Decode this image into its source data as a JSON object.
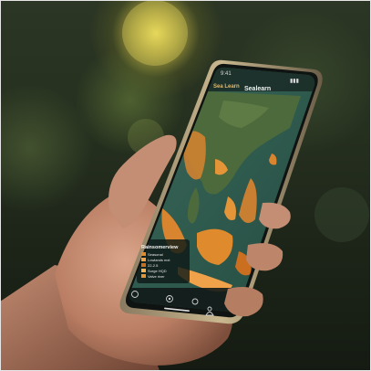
{
  "photo": {
    "description_tag": "hand-holding-smartphone",
    "accent_land": "#d9842f",
    "accent_sea": "#2f5a4e"
  },
  "phone": {
    "status_time": "9:41",
    "status_icons": "▮▮▮",
    "header": {
      "left_label": "Sea Learn",
      "title": "Sealearn"
    },
    "legend": {
      "title": "Rainsomerview",
      "items": [
        {
          "label": "Seasonal",
          "color": "#e08a2e"
        },
        {
          "label": "Lowlands mxt",
          "color": "#f0a24a"
        },
        {
          "label": "22-2.5",
          "color": "#c96f1f"
        },
        {
          "label": "Surge HQD",
          "color": "#f7b35a"
        },
        {
          "label": "Valve river",
          "color": "#e39538"
        }
      ]
    },
    "nav": {
      "home_icon": "home-icon",
      "layers_icon": "layers-icon",
      "location_icon": "location-icon",
      "profile_icon": "profile-icon"
    }
  }
}
